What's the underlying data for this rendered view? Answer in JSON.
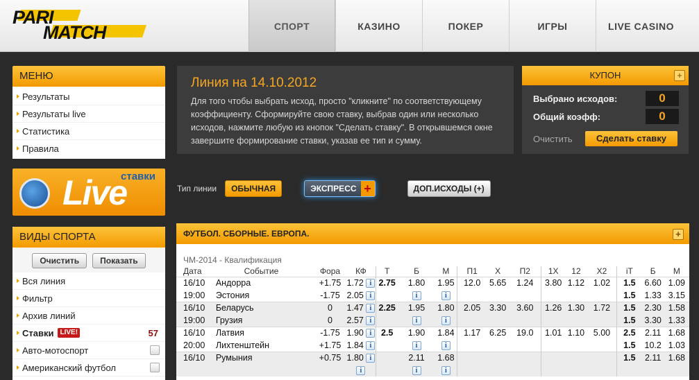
{
  "header": {
    "logo_top": "PARI",
    "logo_bottom": "MATCH",
    "nav": [
      "СПОРТ",
      "КАЗИНО",
      "ПОКЕР",
      "ИГРЫ",
      "LIVE CASINO"
    ]
  },
  "menu": {
    "title": "МЕНЮ",
    "items": [
      "Результаты",
      "Результаты live",
      "Статистика",
      "Правила"
    ]
  },
  "live_banner": {
    "word": "Live",
    "label": "ставки"
  },
  "sports": {
    "title": "ВИДЫ СПОРТА",
    "clear_btn": "Очистить",
    "show_btn": "Показать",
    "items": [
      {
        "label": "Вся линия"
      },
      {
        "label": "Фильтр"
      },
      {
        "label": "Архив линий"
      },
      {
        "label": "Ставки",
        "badge": "LIVE!",
        "count": "57"
      },
      {
        "label": "Авто-мотоспорт"
      },
      {
        "label": "Американский футбол"
      }
    ]
  },
  "info": {
    "title": "Линия на 14.10.2012",
    "text": "Для того чтобы выбрать исход, просто \"кликните\" по соответствующему коэффициенту. Сформируйте свою ставку, выбрав один или несколько исходов, нажмите любую из кнопок \"Сделать ставку\". В открывшемся окне завершите формирование ставки, указав ее тип и сумму."
  },
  "coupon": {
    "title": "КУПОН",
    "selected_label": "Выбрано исходов:",
    "selected_value": "0",
    "total_label": "Общий коэфф:",
    "total_value": "0",
    "clear": "Очистить",
    "bet_btn": "Сделать ставку"
  },
  "linetype": {
    "label": "Тип линии",
    "ordinary": "ОБЫЧНАЯ",
    "express": "ЭКСПРЕСС",
    "express_plus": "+",
    "extra": "ДОП.ИСХОДЫ (+)"
  },
  "odds": {
    "section": "ФУТБОЛ. СБОРНЫЕ. ЕВРОПА.",
    "competition": "ЧМ-2014 - Квалификация",
    "columns": [
      "Дата",
      "Событие",
      "Фора",
      "КФ",
      "Т",
      "Б",
      "М",
      "П1",
      "Х",
      "П2",
      "1Х",
      "12",
      "Х2",
      "iТ",
      "Б",
      "М"
    ],
    "matches": [
      {
        "date": "16/10",
        "time": "19:00",
        "team1": "Андорра",
        "team2": "Эстония",
        "fora1": "+1.75",
        "kf1": "1.72",
        "fora2": "-1.75",
        "kf2": "2.05",
        "t": "2.75",
        "b": "1.80",
        "m": "1.95",
        "p1": "12.0",
        "x": "5.65",
        "p2": "1.24",
        "x1": "3.80",
        "x12": "1.12",
        "x2": "1.02",
        "it1": "1.5",
        "itb1": "6.60",
        "itm1": "1.09",
        "it2": "1.5",
        "itb2": "1.33",
        "itm2": "3.15"
      },
      {
        "date": "16/10",
        "time": "19:00",
        "team1": "Беларусь",
        "team2": "Грузия",
        "fora1": "0",
        "kf1": "1.47",
        "fora2": "0",
        "kf2": "2.57",
        "t": "2.25",
        "b": "1.95",
        "m": "1.80",
        "p1": "2.05",
        "x": "3.30",
        "p2": "3.60",
        "x1": "1.26",
        "x12": "1.30",
        "x2": "1.72",
        "it1": "1.5",
        "itb1": "2.30",
        "itm1": "1.58",
        "it2": "1.5",
        "itb2": "3.30",
        "itm2": "1.33"
      },
      {
        "date": "16/10",
        "time": "20:00",
        "team1": "Латвия",
        "team2": "Лихтенштейн",
        "fora1": "-1.75",
        "kf1": "1.90",
        "fora2": "+1.75",
        "kf2": "1.84",
        "t": "2.5",
        "b": "1.90",
        "m": "1.84",
        "p1": "1.17",
        "x": "6.25",
        "p2": "19.0",
        "x1": "1.01",
        "x12": "1.10",
        "x2": "5.00",
        "it1": "2.5",
        "itb1": "2.11",
        "itm1": "1.68",
        "it2": "1.5",
        "itb2": "10.2",
        "itm2": "1.03"
      },
      {
        "date": "16/10",
        "time": "",
        "team1": "Румыния",
        "team2": "",
        "fora1": "+0.75",
        "kf1": "1.80",
        "fora2": "",
        "kf2": "",
        "t": "",
        "b": "2.11",
        "m": "1.68",
        "p1": "",
        "x": "",
        "p2": "",
        "x1": "",
        "x12": "",
        "x2": "",
        "it1": "1.5",
        "itb1": "2.11",
        "itm1": "1.68",
        "it2": "",
        "itb2": "",
        "itm2": ""
      }
    ]
  },
  "colors": {
    "accent": "#f5a623",
    "bg": "#2a2a2a",
    "panel": "#3c3c3c"
  }
}
